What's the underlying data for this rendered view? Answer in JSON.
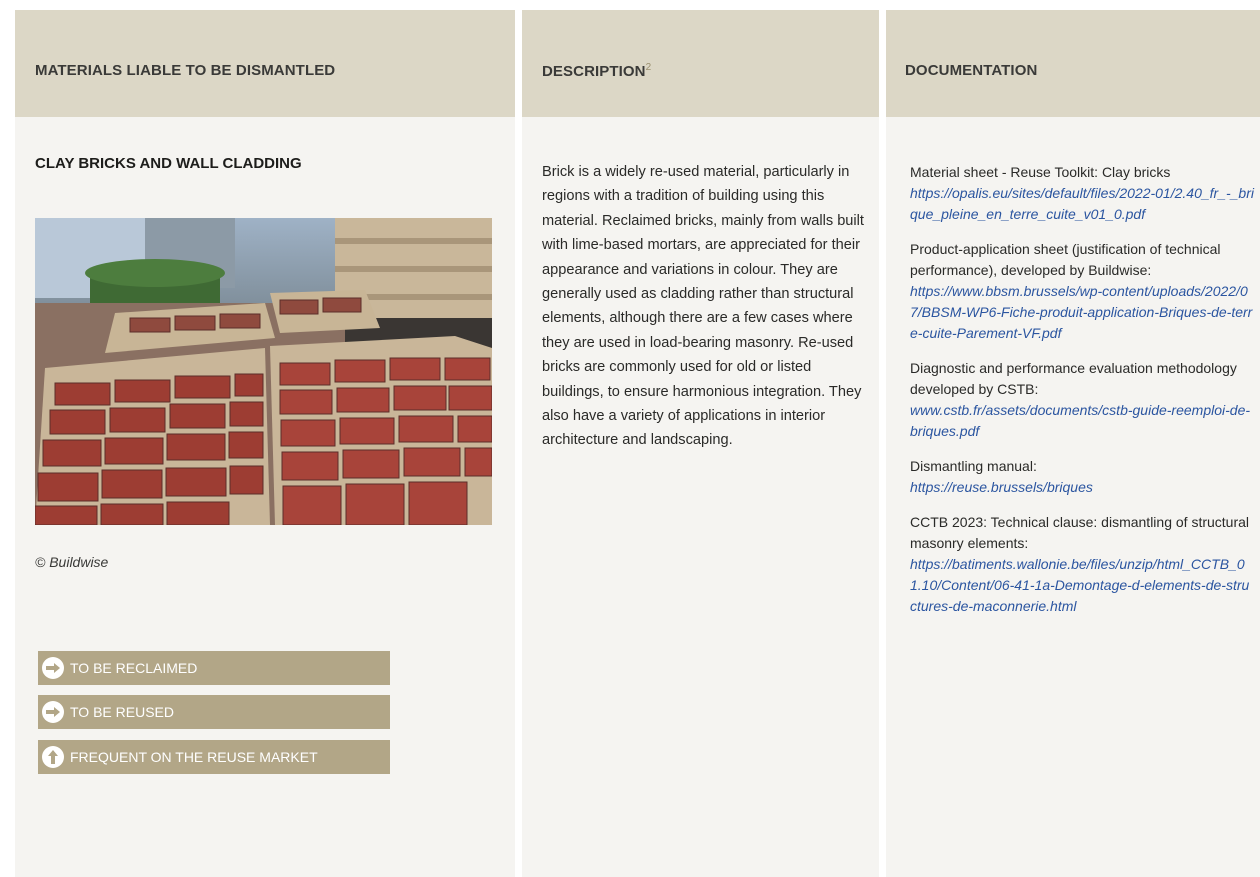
{
  "columns": {
    "materials_header": "MATERIALS LIABLE TO BE DISMANTLED",
    "description_header": "DESCRIPTION",
    "description_footnote": "2",
    "documentation_header": "DOCUMENTATION"
  },
  "material": {
    "title": "CLAY BRICKS AND WALL CLADDING",
    "photo_credit": "© Buildwise",
    "tags": [
      {
        "label": "TO BE RECLAIMED",
        "icon": "arrow-right-icon"
      },
      {
        "label": "TO BE REUSED",
        "icon": "arrow-right-icon"
      },
      {
        "label": "FREQUENT ON THE REUSE MARKET",
        "icon": "arrow-up-icon"
      }
    ]
  },
  "description": {
    "text": "Brick is a widely re-used material, particularly in regions with a tradition of building using this material. Reclaimed bricks, mainly from walls built with lime-based mortars, are appreciated for their appearance and variations in colour. They are generally used as cladding rather than structural elements, although there are a few cases where they are used in load-bearing masonry. Re-used bricks are commonly used for old or listed buildings, to ensure harmonious integration. They also have a variety of applications in interior architecture and landscaping."
  },
  "documentation": [
    {
      "text": "Material sheet - Reuse Toolkit: Clay bricks",
      "link": "https://opalis.eu/sites/default/files/2022-01/2.40_fr_-_brique_pleine_en_terre_cuite_v01_0.pdf"
    },
    {
      "text": "Product-application sheet (justification of technical performance), developed by Buildwise:",
      "link": "https://www.bbsm.brussels/wp-content/uploads/2022/07/BBSM-WP6-Fiche-produit-application-Briques-de-terre-cuite-Parement-VF.pdf"
    },
    {
      "text": "Diagnostic and performance evaluation methodology developed by CSTB:",
      "link": "www.cstb.fr/assets/documents/cstb-guide-reemploi-de-briques.pdf"
    },
    {
      "text": "Dismantling manual:",
      "link": "https://reuse.brussels/briques"
    },
    {
      "text": "CCTB 2023: Technical clause: dismantling of structural masonry elements:",
      "link": "https://batiments.wallonie.be/files/unzip/html_CCTB_01.10/Content/06-41-1a-Demontage-d-elements-de-structures-de-maconnerie.html"
    }
  ],
  "colors": {
    "header_bg": "#dcd7c6",
    "cell_bg": "#f5f4f1",
    "tag_bg": "#b2a687",
    "link": "#2b55a0"
  }
}
